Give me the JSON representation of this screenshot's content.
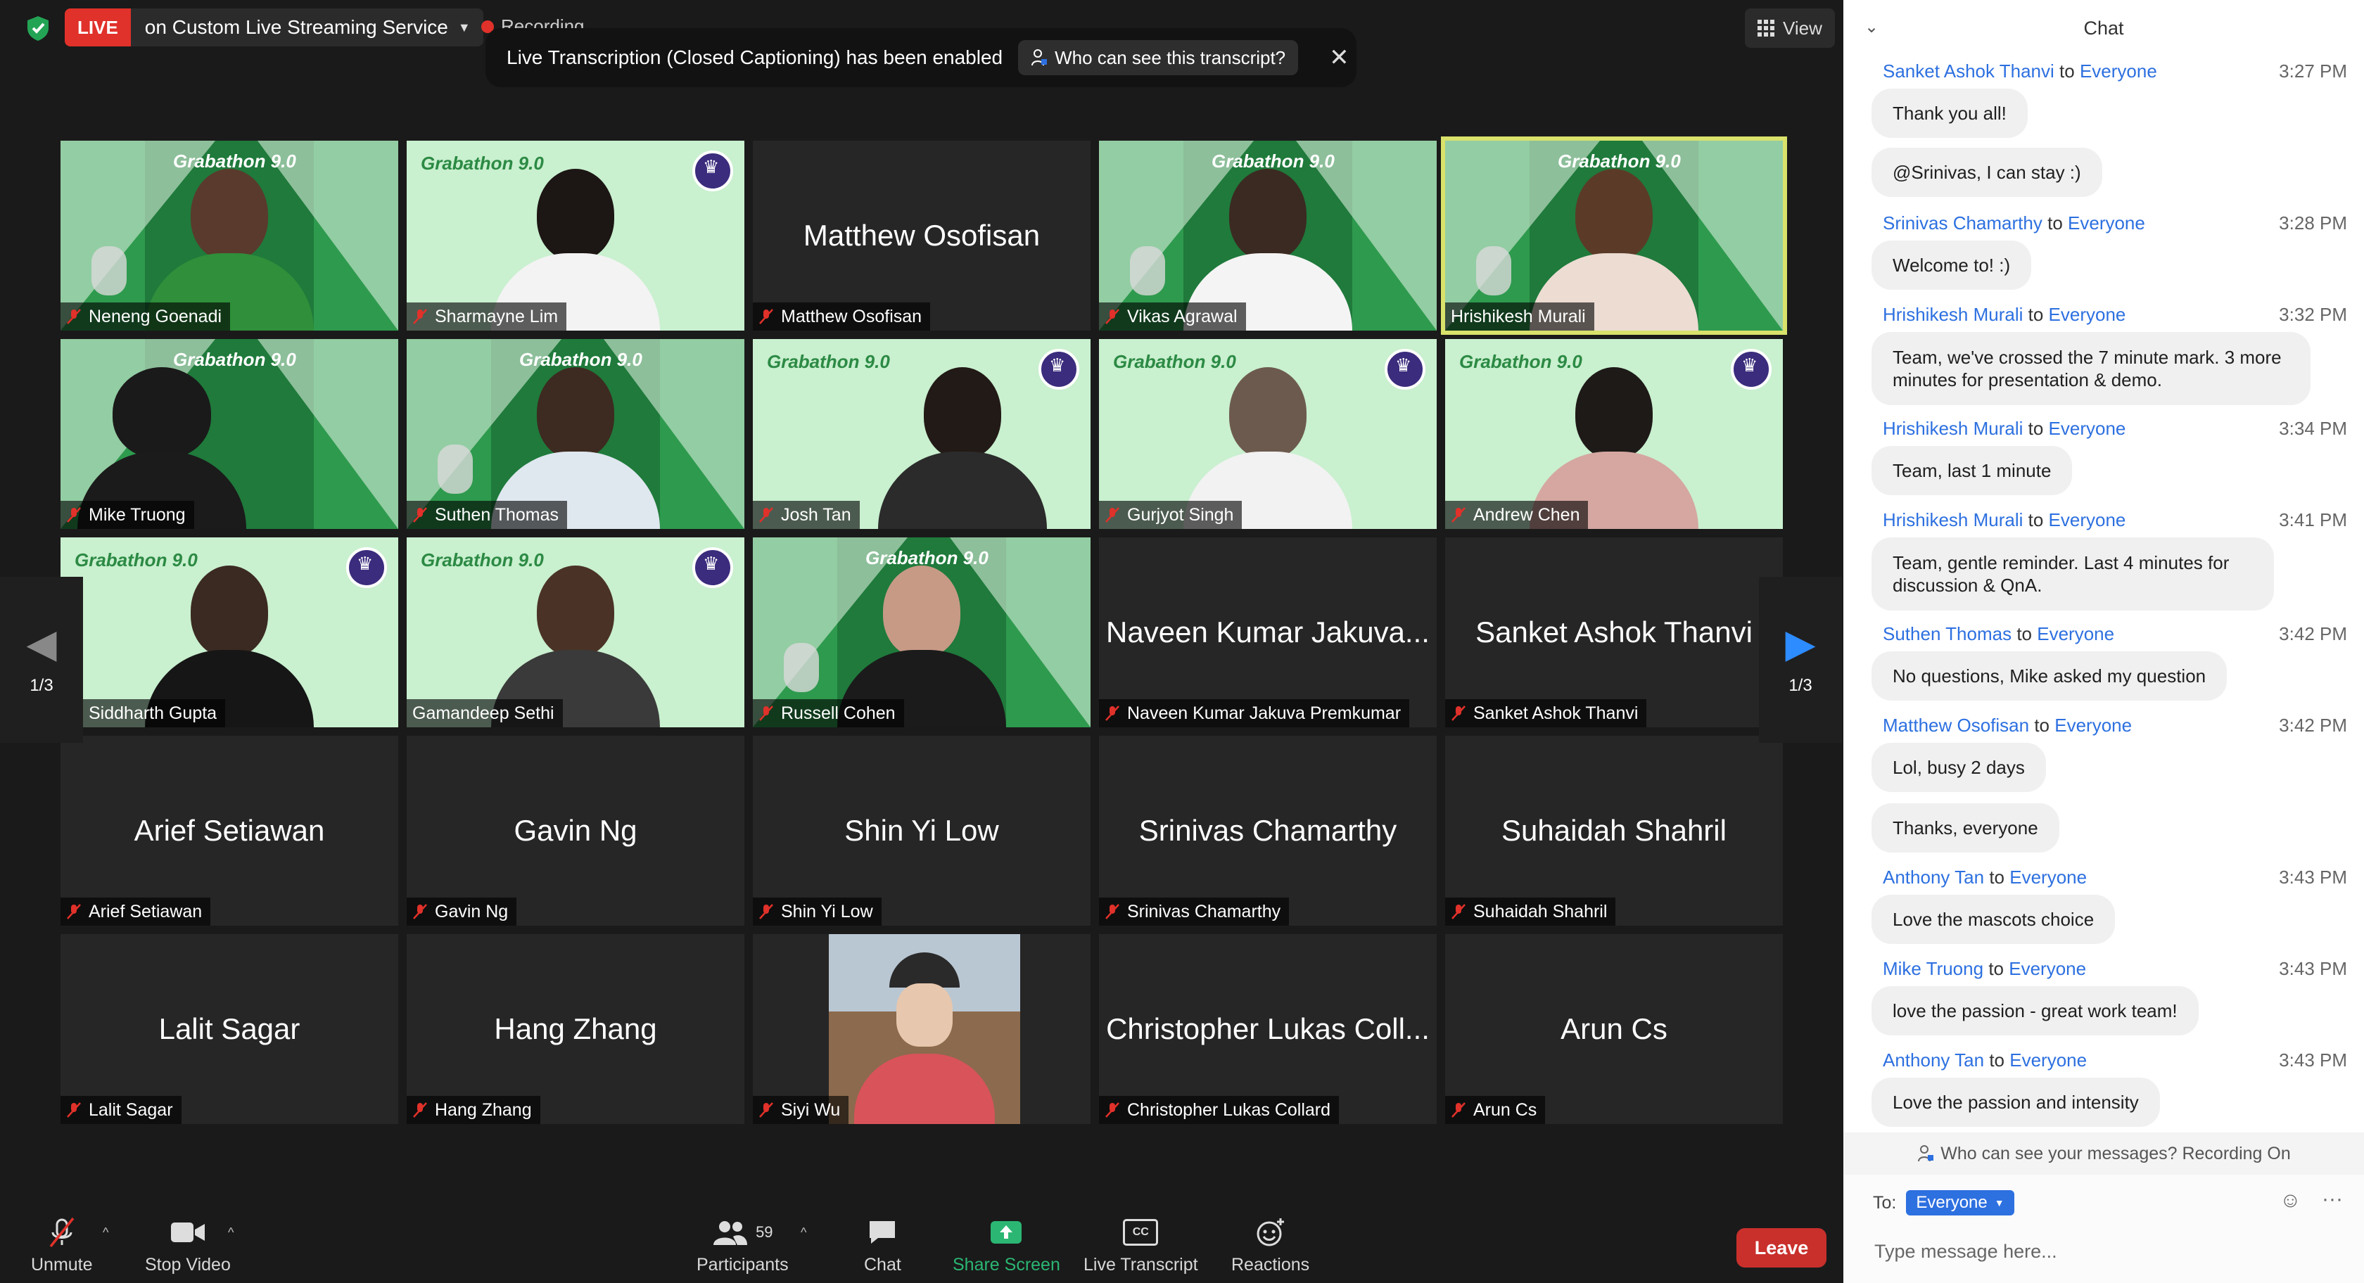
{
  "topbar": {
    "live_badge": "LIVE",
    "live_service": "on Custom Live Streaming Service",
    "recording": "Recording",
    "notice_text": "Live Transcription (Closed Captioning) has been enabled",
    "who_transcript": "Who can see this transcript?",
    "view_label": "View"
  },
  "tiles": [
    {
      "name": "Neneng Goenadi",
      "logo": "Grabathon 9.0"
    },
    {
      "name": "Sharmayne Lim",
      "logo": "Grabathon 9.0"
    },
    {
      "name": "Matthew Osofisan",
      "center": "Matthew Osofisan"
    },
    {
      "name": "Vikas Agrawal",
      "logo": "Grabathon 9.0"
    },
    {
      "name": "Hrishikesh Murali",
      "logo": "Grabathon 9.0"
    },
    {
      "name": "Mike Truong",
      "logo": "Grabathon 9.0"
    },
    {
      "name": "Suthen Thomas",
      "logo": "Grabathon 9.0"
    },
    {
      "name": "Josh Tan",
      "logo": "Grabathon 9.0"
    },
    {
      "name": "Gurjyot Singh",
      "logo": "Grabathon 9.0"
    },
    {
      "name": "Andrew Chen",
      "logo": "Grabathon 9.0"
    },
    {
      "name": "Siddharth Gupta",
      "logo": "Grabathon 9.0"
    },
    {
      "name": "Gamandeep Sethi",
      "logo": "Grabathon 9.0"
    },
    {
      "name": "Russell Cohen",
      "logo": "Grabathon 9.0"
    },
    {
      "name": "Naveen Kumar Jakuva Premkumar",
      "center": "Naveen Kumar Jakuva..."
    },
    {
      "name": "Sanket Ashok Thanvi",
      "center": "Sanket Ashok Thanvi"
    },
    {
      "name": "Arief Setiawan",
      "center": "Arief Setiawan"
    },
    {
      "name": "Gavin Ng",
      "center": "Gavin Ng"
    },
    {
      "name": "Shin Yi Low",
      "center": "Shin Yi Low"
    },
    {
      "name": "Srinivas Chamarthy",
      "center": "Srinivas Chamarthy"
    },
    {
      "name": "Suhaidah Shahril",
      "center": "Suhaidah Shahril"
    },
    {
      "name": "Lalit Sagar",
      "center": "Lalit Sagar"
    },
    {
      "name": "Hang Zhang",
      "center": "Hang Zhang"
    },
    {
      "name": "Siyi Wu"
    },
    {
      "name": "Christopher Lukas Collard",
      "center": "Christopher Lukas Coll..."
    },
    {
      "name": "Arun Cs",
      "center": "Arun Cs"
    }
  ],
  "pagination": {
    "left": "1/3",
    "right": "1/3"
  },
  "toolbar": {
    "unmute": "Unmute",
    "stop_video": "Stop Video",
    "participants": "Participants",
    "participant_count": "59",
    "chat": "Chat",
    "share_screen": "Share Screen",
    "live_transcript": "Live Transcript",
    "cc_badge": "CC",
    "reactions": "Reactions",
    "leave": "Leave"
  },
  "chat": {
    "title": "Chat",
    "to_word": "to",
    "messages": [
      {
        "from": "Sanket Ashok Thanvi",
        "to": "Everyone",
        "time": "3:27 PM",
        "texts": [
          "Thank you all!",
          "@Srinivas, I can stay :)"
        ]
      },
      {
        "from": "Srinivas Chamarthy",
        "to": "Everyone",
        "time": "3:28 PM",
        "texts": [
          "Welcome to! :)"
        ]
      },
      {
        "from": "Hrishikesh Murali",
        "to": "Everyone",
        "time": "3:32 PM",
        "texts": [
          "Team, we've crossed the 7 minute mark. 3 more minutes for presentation & demo."
        ]
      },
      {
        "from": "Hrishikesh Murali",
        "to": "Everyone",
        "time": "3:34 PM",
        "texts": [
          "Team, last 1 minute"
        ]
      },
      {
        "from": "Hrishikesh Murali",
        "to": "Everyone",
        "time": "3:41 PM",
        "texts": [
          "Team, gentle reminder. Last 4 minutes for discussion & QnA."
        ]
      },
      {
        "from": "Suthen Thomas",
        "to": "Everyone",
        "time": "3:42 PM",
        "texts": [
          "No questions, Mike asked my question"
        ]
      },
      {
        "from": "Matthew Osofisan",
        "to": "Everyone",
        "time": "3:42 PM",
        "texts": [
          "Lol, busy 2 days",
          "Thanks, everyone"
        ]
      },
      {
        "from": "Anthony Tan",
        "to": "Everyone",
        "time": "3:43 PM",
        "texts": [
          "Love the mascots choice"
        ]
      },
      {
        "from": "Mike Truong",
        "to": "Everyone",
        "time": "3:43 PM",
        "texts": [
          "love the passion - great work team!"
        ]
      },
      {
        "from": "Anthony Tan",
        "to": "Everyone",
        "time": "3:43 PM",
        "texts": [
          "Love the passion and intensity"
        ]
      }
    ],
    "who_can_see": "Who can see your messages? Recording On",
    "to_label": "To:",
    "to_value": "Everyone",
    "input_placeholder": "Type message here..."
  },
  "colors": {
    "accent": "#2d70e0",
    "live": "#e0312a",
    "leave": "#c9302c",
    "speaker_outline": "#d9e26b",
    "share": "#2bb673"
  }
}
